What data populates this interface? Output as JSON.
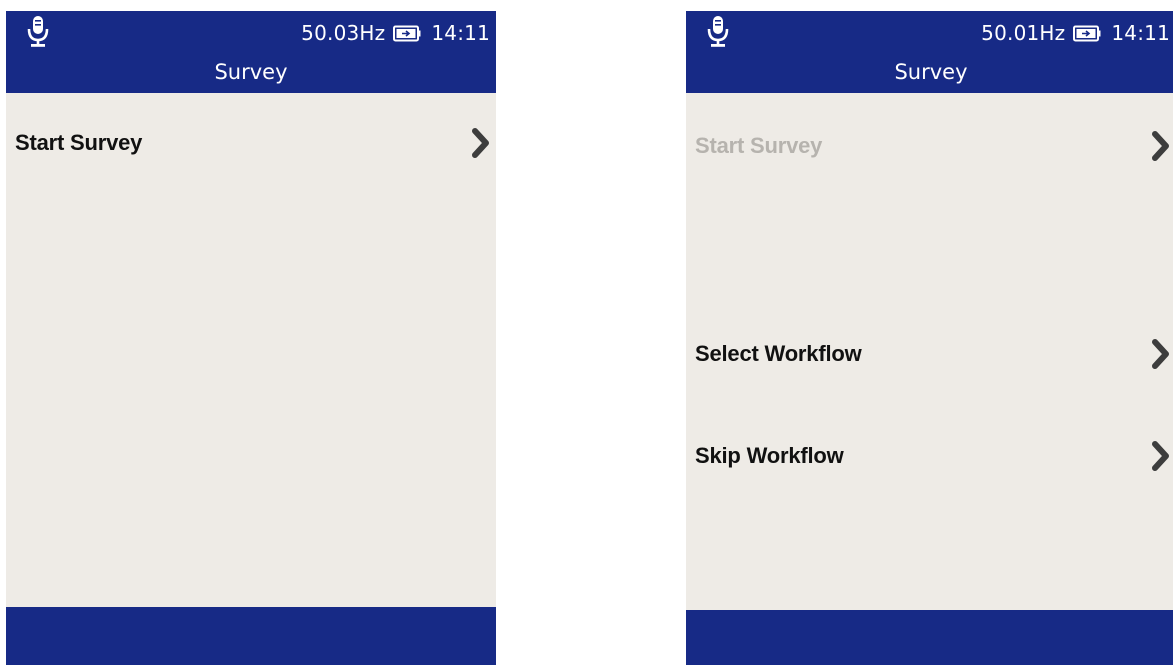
{
  "screens": [
    {
      "frequency": "50.03Hz",
      "time": "14:11",
      "title": "Survey",
      "items": [
        {
          "label": "Start Survey",
          "enabled": true
        }
      ]
    },
    {
      "frequency": "50.01Hz",
      "time": "14:11",
      "title": "Survey",
      "items": [
        {
          "label": "Start Survey",
          "enabled": false
        },
        {
          "label": "Select Workflow",
          "enabled": true
        },
        {
          "label": "Skip Workflow",
          "enabled": true
        }
      ]
    }
  ],
  "icons": {
    "status_left": "microphone-icon",
    "battery": "battery-charging-icon",
    "item_arrow": "chevron-right-icon"
  },
  "colors": {
    "header_bg": "#172a86",
    "screen_bg": "#eeebe6",
    "item_text": "#111111",
    "item_text_disabled": "#b6b3ae",
    "chevron": "#3d3d3d"
  }
}
